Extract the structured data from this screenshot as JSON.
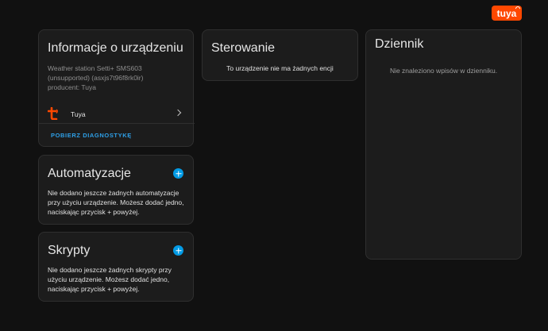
{
  "brand": {
    "logo_text": "tuya",
    "accent": "#ff4800",
    "icon": "tuya-logo"
  },
  "device_info": {
    "title": "Informacje o urządzeniu",
    "description_line1": "Weather station Setti+ SMS603",
    "description_line2": "(unsupported) (asxjs7t96f8rk0ir)",
    "description_line3": "producent: Tuya",
    "integration_label": "Tuya",
    "integration_icon": "tuya-icon",
    "diagnostics_button": "POBIERZ DIAGNOSTYKĘ"
  },
  "controls": {
    "title": "Sterowanie",
    "empty_message": "To urządzenie nie ma żadnych encji"
  },
  "logbook": {
    "title": "Dziennik",
    "empty_message": "Nie znaleziono wpisów w dzienniku."
  },
  "automations": {
    "title": "Automatyzacje",
    "body": "Nie dodano jeszcze żadnych automatyzacje przy użyciu urządzenie. Możesz dodać jedno, naciskając przycisk + powyżej.",
    "add_icon": "plus-circle-icon"
  },
  "scripts": {
    "title": "Skrypty",
    "body": "Nie dodano jeszcze żadnych skrypty przy użyciu urządzenie. Możesz dodać jedno, naciskając przycisk + powyżej.",
    "add_icon": "plus-circle-icon"
  },
  "colors": {
    "background": "#111111",
    "card": "#1c1c1c",
    "link": "#2ea0e8",
    "add_button": "#039be5"
  }
}
